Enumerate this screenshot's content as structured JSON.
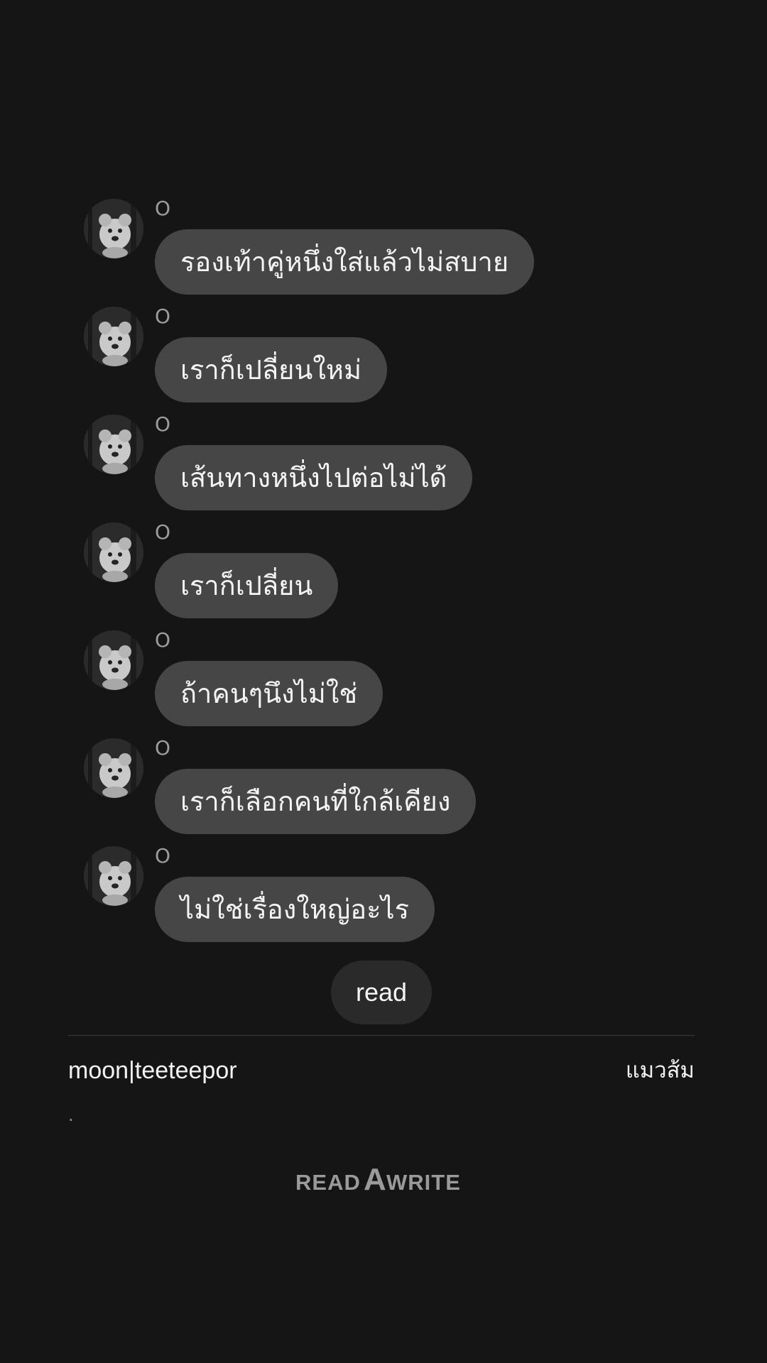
{
  "messages": [
    {
      "sender": "O",
      "text": "รองเท้าคู่หนึ่งใส่แล้วไม่สบาย",
      "avatar_icon": "dog-avatar-icon"
    },
    {
      "sender": "O",
      "text": "เราก็เปลี่ยนใหม่",
      "avatar_icon": "dog-avatar-icon"
    },
    {
      "sender": "O",
      "text": "เส้นทางหนึ่งไปต่อไม่ได้",
      "avatar_icon": "dog-avatar-icon"
    },
    {
      "sender": "O",
      "text": "เราก็เปลี่ยน",
      "avatar_icon": "dog-avatar-icon"
    },
    {
      "sender": "O",
      "text": "ถ้าคนๆนึงไม่ใช่",
      "avatar_icon": "dog-avatar-icon"
    },
    {
      "sender": "O",
      "text": "เราก็เลือกคนที่ใกล้เคียง",
      "avatar_icon": "dog-avatar-icon"
    },
    {
      "sender": "O",
      "text": "ไม่ใช่เรื่องใหญ่อะไร",
      "avatar_icon": "dog-avatar-icon"
    }
  ],
  "read_button": {
    "label": "read"
  },
  "footer": {
    "author": "moon|teeteepor",
    "category": "แมวส้ม",
    "dot": "."
  },
  "logo": {
    "part1": "READ",
    "part2": "A",
    "part3": "WRITE",
    "color": "#9a9a9a"
  },
  "colors": {
    "background": "#151515",
    "bubble": "#464646",
    "read_button": "#2a2a2a"
  }
}
